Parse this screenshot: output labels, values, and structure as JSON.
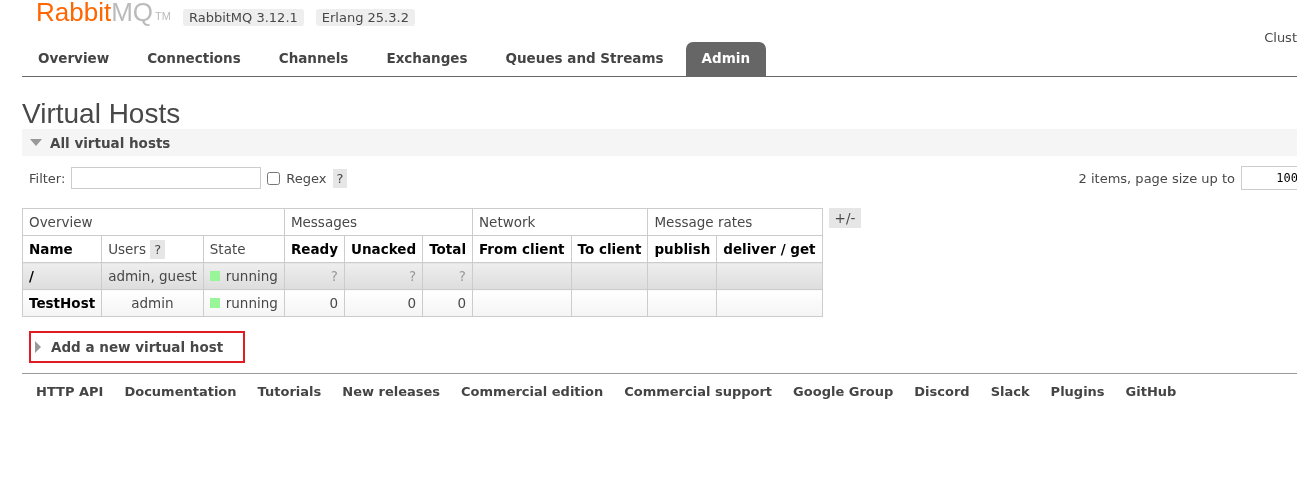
{
  "header": {
    "logo": {
      "part_1": "Rabbit",
      "part_2": "MQ",
      "trademark": "TM"
    },
    "versions": [
      "RabbitMQ 3.12.1",
      "Erlang 25.3.2"
    ],
    "cluster": "Clust"
  },
  "tabs": [
    {
      "label": "Overview",
      "selected": false
    },
    {
      "label": "Connections",
      "selected": false
    },
    {
      "label": "Channels",
      "selected": false
    },
    {
      "label": "Exchanges",
      "selected": false
    },
    {
      "label": "Queues and Streams",
      "selected": false
    },
    {
      "label": "Admin",
      "selected": true
    }
  ],
  "page_title": "Virtual Hosts",
  "section": {
    "title": "All virtual hosts",
    "expanded": true
  },
  "filter": {
    "label": "Filter:",
    "regex_label": "Regex",
    "regex_checked": false,
    "help": "?",
    "count_text": "2 items, page size up to",
    "page_size": "100"
  },
  "table": {
    "groups": [
      {
        "label": "Overview"
      },
      {
        "label": "Messages"
      },
      {
        "label": "Network"
      },
      {
        "label": "Message rates"
      }
    ],
    "columns": [
      {
        "label": "Name",
        "bold": true
      },
      {
        "label": "Users",
        "bold": false,
        "help": "?"
      },
      {
        "label": "State",
        "bold": false
      },
      {
        "label": "Ready",
        "bold": true
      },
      {
        "label": "Unacked",
        "bold": true
      },
      {
        "label": "Total",
        "bold": true
      },
      {
        "label": "From client",
        "bold": true
      },
      {
        "label": "To client",
        "bold": true
      },
      {
        "label": "publish",
        "bold": true
      },
      {
        "label": "deliver / get",
        "bold": true
      }
    ],
    "toggle": "+/-",
    "rows": [
      {
        "name": "/",
        "users": "admin, guest",
        "state": {
          "label": "running",
          "color": "#98f598"
        },
        "ready": "?",
        "unacked": "?",
        "total": "?",
        "unknown": true
      },
      {
        "name": "TestHost",
        "users": "admin",
        "state": {
          "label": "running",
          "color": "#98f598"
        },
        "ready": "0",
        "unacked": "0",
        "total": "0",
        "unknown": false
      }
    ]
  },
  "add_section": {
    "title": "Add a new virtual host",
    "expanded": false,
    "highlighted": true
  },
  "footer_links": [
    "HTTP API",
    "Documentation",
    "Tutorials",
    "New releases",
    "Commercial edition",
    "Commercial support",
    "Google Group",
    "Discord",
    "Slack",
    "Plugins",
    "GitHub"
  ]
}
